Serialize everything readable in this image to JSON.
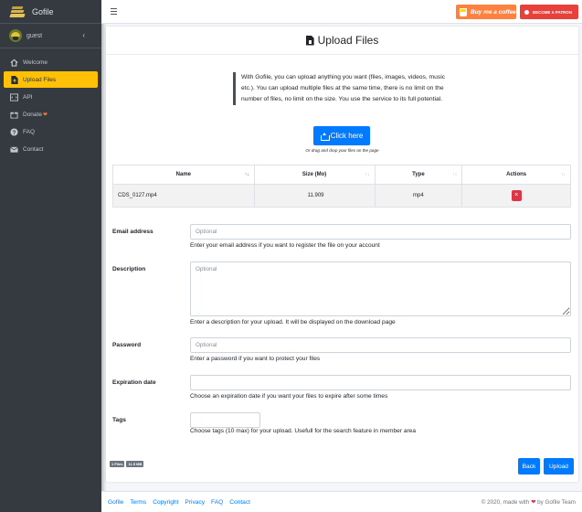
{
  "brand": {
    "name": "Gofile"
  },
  "user": {
    "name": "guest"
  },
  "sidebar": {
    "items": [
      {
        "label": "Welcome",
        "icon": "home-icon"
      },
      {
        "label": "Upload Files",
        "icon": "file-upload-icon",
        "active": true
      },
      {
        "label": "API",
        "icon": "code-icon"
      },
      {
        "label": "Donate",
        "icon": "donate-icon"
      },
      {
        "label": "FAQ",
        "icon": "question-icon"
      },
      {
        "label": "Contact",
        "icon": "envelope-icon"
      }
    ]
  },
  "topbar": {
    "coffee_label": "Buy me a coffee",
    "patreon_label": "BECOME A PATRON"
  },
  "page": {
    "title": "Upload Files",
    "intro": "With Gofile, you can upload anything you want (files, images, videos, music etc.). You can upload multiple files at the same time, there is no limit on the number of files, no limit on the size. You use the service to its full potential.",
    "upload_button": "Click here",
    "drop_hint": "Or drag and drop your files on the page"
  },
  "table": {
    "headers": [
      "Name",
      "Size (Mo)",
      "Type",
      "Actions"
    ],
    "rows": [
      {
        "name": "CDS_0127.mp4",
        "size": "11.909",
        "type": "mp4",
        "action": "×"
      }
    ]
  },
  "form": {
    "email": {
      "label": "Email address",
      "placeholder": "Optional",
      "help": "Enter your email address if you want to register the file on your account"
    },
    "description": {
      "label": "Description",
      "placeholder": "Optional",
      "help": "Enter a description for your upload. It will be displayed on the download page"
    },
    "password": {
      "label": "Password",
      "placeholder": "Optional",
      "help": "Enter a password if you want to protect your files"
    },
    "expiration": {
      "label": "Expiration date",
      "placeholder": "",
      "help": "Choose an expiration date if you want your files to expire after some times"
    },
    "tags": {
      "label": "Tags",
      "placeholder": "",
      "help": "Choose tags (10 max) for your upload. Usefull for the search feature in member area"
    }
  },
  "summary": {
    "files_badge": "1 Files",
    "size_badge": "11.9 MB"
  },
  "actions": {
    "back": "Back",
    "upload": "Upload"
  },
  "footer": {
    "links": [
      "Gofile",
      "Terms",
      "Copyright",
      "Privacy",
      "FAQ",
      "Contact"
    ],
    "credit_prefix": "© 2020, made with",
    "credit_suffix": "by Gofile Team"
  },
  "colors": {
    "accent": "#ffc107",
    "primary": "#007bff",
    "sidebar": "#343a40",
    "danger": "#dc3545",
    "coffee": "#ff813f",
    "patreon": "#e8413b"
  }
}
